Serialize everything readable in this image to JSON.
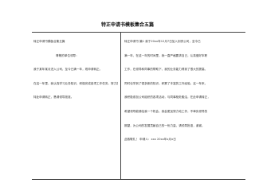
{
  "document": {
    "title": "特正申请书模板集合五篇",
    "left_column": [
      "转正申请书模板合集五篇",
      "尊敬的单位领导：",
      "我于某年某月进入公司，至今已满一年，现申请转正。",
      "在这一年里，我认真学习业务知识，积极完成各项工作任务，努力提高自身能力。",
      "特此申请转正，恳请领导批准。"
    ],
    "right_column": [
      "转正申请书 篇1 我于20xx年12月7日加入到贵公司，至今已",
      "满一年，在这一年的时间里，我一直严格要求自己，认真做好本职",
      "工作，在领导和同事的帮助下，我的业务能力得到了很大的提高，",
      "同时也学到了很多新的知识，积累了丰富的工作经验。这一年来，",
      "我积极参加公司组织的各项活动，与同事相处融洽，在此申请转正，",
      "希望领导能够给我一个机会，我会更加努力地工作，不辜负领导的",
      "期望，为公司的发展贡献自己的一份力量，请领导批准，谢谢。",
      "此致敬礼！ 申请人：xxx 20xx年x月x日"
    ]
  }
}
